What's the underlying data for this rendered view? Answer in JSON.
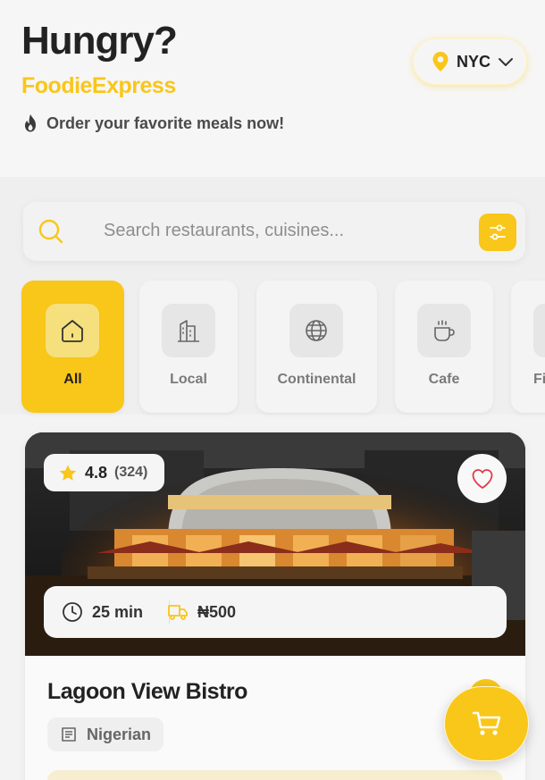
{
  "header": {
    "headline": "Hungry?",
    "brand": "FoodieExpress",
    "tagline": "Order your favorite meals now!",
    "city": "NYC"
  },
  "search": {
    "placeholder": "Search restaurants, cuisines..."
  },
  "categories": [
    {
      "label": "All",
      "icon": "home-icon",
      "active": true
    },
    {
      "label": "Local",
      "icon": "building-icon",
      "active": false
    },
    {
      "label": "Continental",
      "icon": "globe-icon",
      "active": false
    },
    {
      "label": "Cafe",
      "icon": "coffee-cup-icon",
      "active": false
    },
    {
      "label": "Fi",
      "icon": "fish-icon",
      "active": false
    }
  ],
  "restaurant": {
    "rating": "4.8",
    "reviews": "(324)",
    "delivery_time": "25 min",
    "delivery_fee": "₦500",
    "name": "Lagoon View Bistro",
    "cuisine": "Nigerian"
  },
  "colors": {
    "accent": "#f9c61a",
    "background": "#f3f3f3",
    "text": "#222222"
  }
}
